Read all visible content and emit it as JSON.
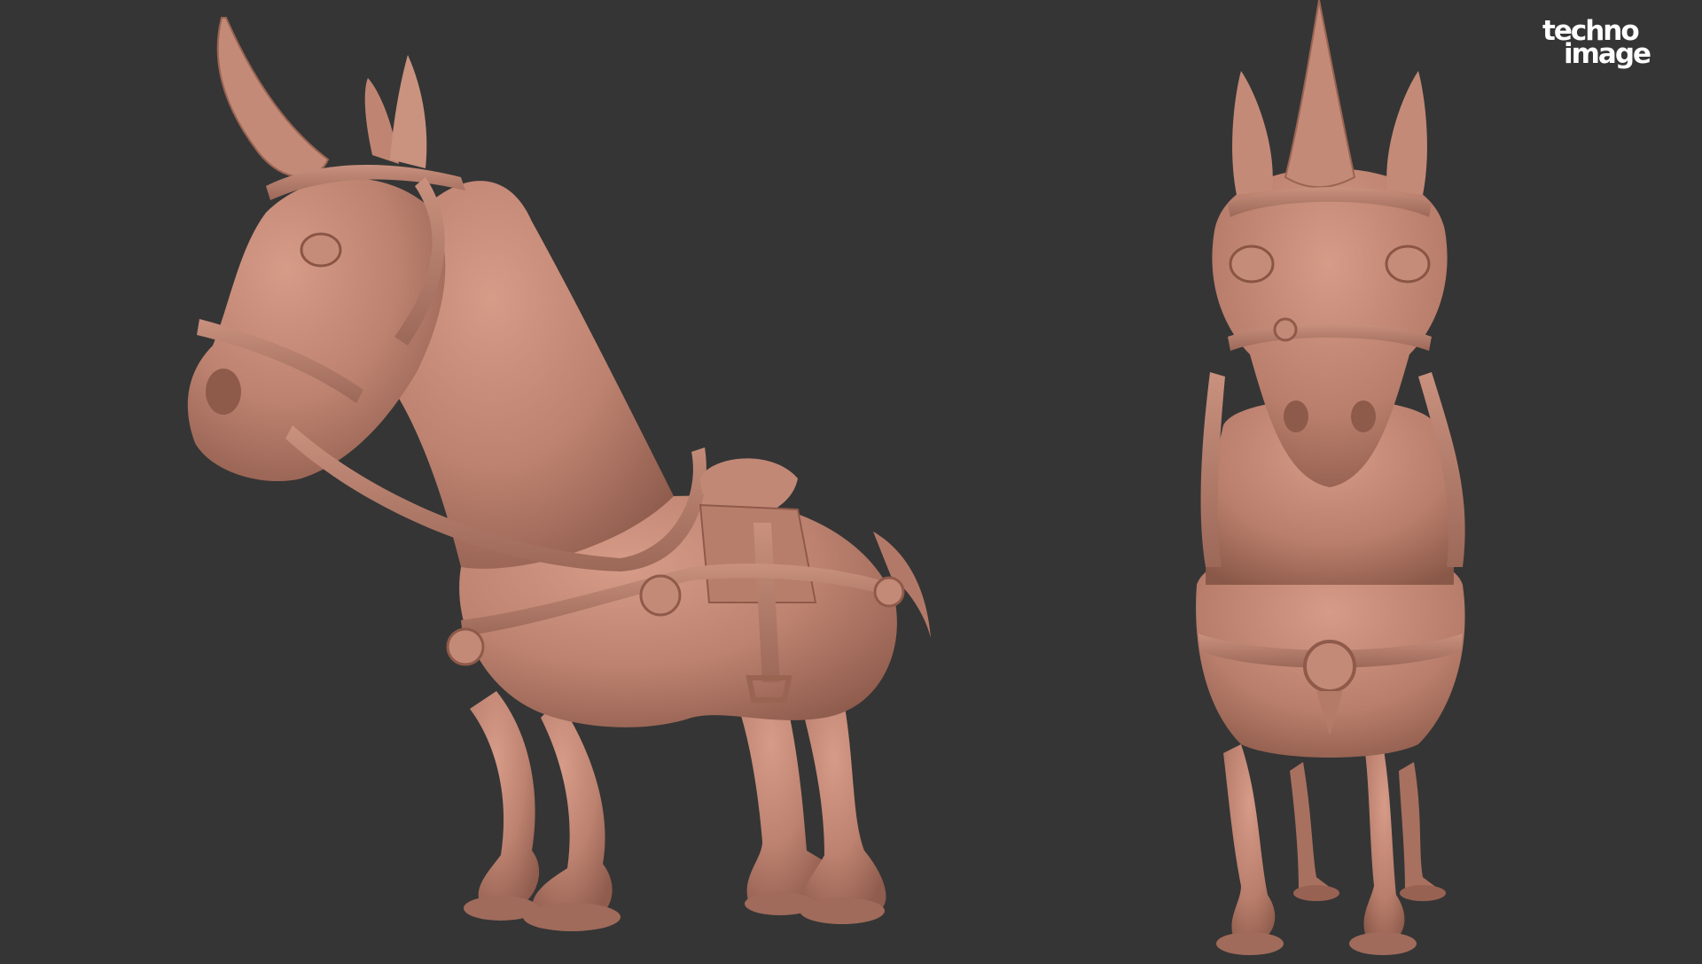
{
  "scene": {
    "background": "#353535",
    "clay_color": "#c48a78",
    "subjects": [
      "horse-three-quarter-view",
      "horse-front-view"
    ]
  },
  "logo": {
    "line1": "techno",
    "line2": "image",
    "color": "#ffffff"
  }
}
